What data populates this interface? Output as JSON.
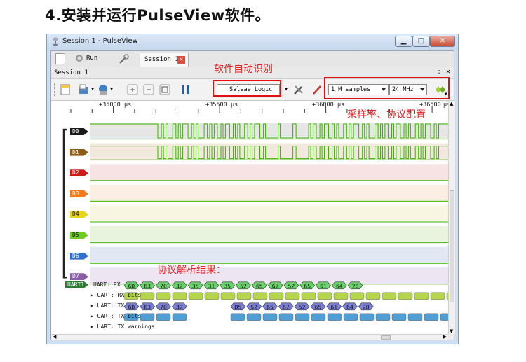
{
  "heading": "4.安装并运行PulseView软件。",
  "window": {
    "title": "Session 1 - PulseView"
  },
  "tabbar": {
    "run_label": "Run",
    "tab_label": "Session 1"
  },
  "session_label": "Session 1",
  "toolbar": {
    "device": "Saleae Logic",
    "samples": "1 M samples",
    "rate": "24 MHz"
  },
  "annotations": {
    "device_auto": "软件自动识别",
    "sample_config": "采样率、协议配置",
    "decode_result": "协议解析结果："
  },
  "ruler": {
    "unit": "µs",
    "ticks": [
      "+35000",
      "+35500",
      "+36000",
      "+36500"
    ]
  },
  "channels": [
    {
      "name": "D0",
      "color": "#1a1a1a",
      "bg": "#e6e6e6"
    },
    {
      "name": "D1",
      "color": "#8b5a14",
      "bg": "#f1e9de"
    },
    {
      "name": "D2",
      "color": "#d01b1b",
      "bg": "#f8e3e4"
    },
    {
      "name": "D3",
      "color": "#f07c1c",
      "bg": "#fbeee2"
    },
    {
      "name": "D4",
      "color": "#e8d418",
      "bg": "#f8f6e1"
    },
    {
      "name": "D5",
      "color": "#6fcb1e",
      "bg": "#e9f4df"
    },
    {
      "name": "D6",
      "color": "#2f6fce",
      "bg": "#e1e8f4"
    },
    {
      "name": "D7",
      "color": "#8a5fa8",
      "bg": "#ede6f2"
    }
  ],
  "decoder": {
    "badge": "UART1",
    "rows": [
      "UART: RX",
      "UART: RX bits",
      "UART: TX",
      "UART: TX bits",
      "UART: TX warnings"
    ],
    "rx_values": [
      "6D",
      "63",
      "70",
      "32",
      "35",
      "31",
      "35",
      "52",
      "65",
      "67",
      "52",
      "65",
      "61",
      "64",
      "28"
    ],
    "tx_values": [
      "6D",
      "63",
      "70",
      "32",
      "D5",
      "52",
      "65",
      "67",
      "52",
      "65",
      "61",
      "64",
      "28"
    ]
  },
  "colors": {
    "accent_red": "#e01010",
    "signal": "#6fcb1e",
    "rx": "#6bd36b",
    "tx": "#7b7fd6"
  }
}
